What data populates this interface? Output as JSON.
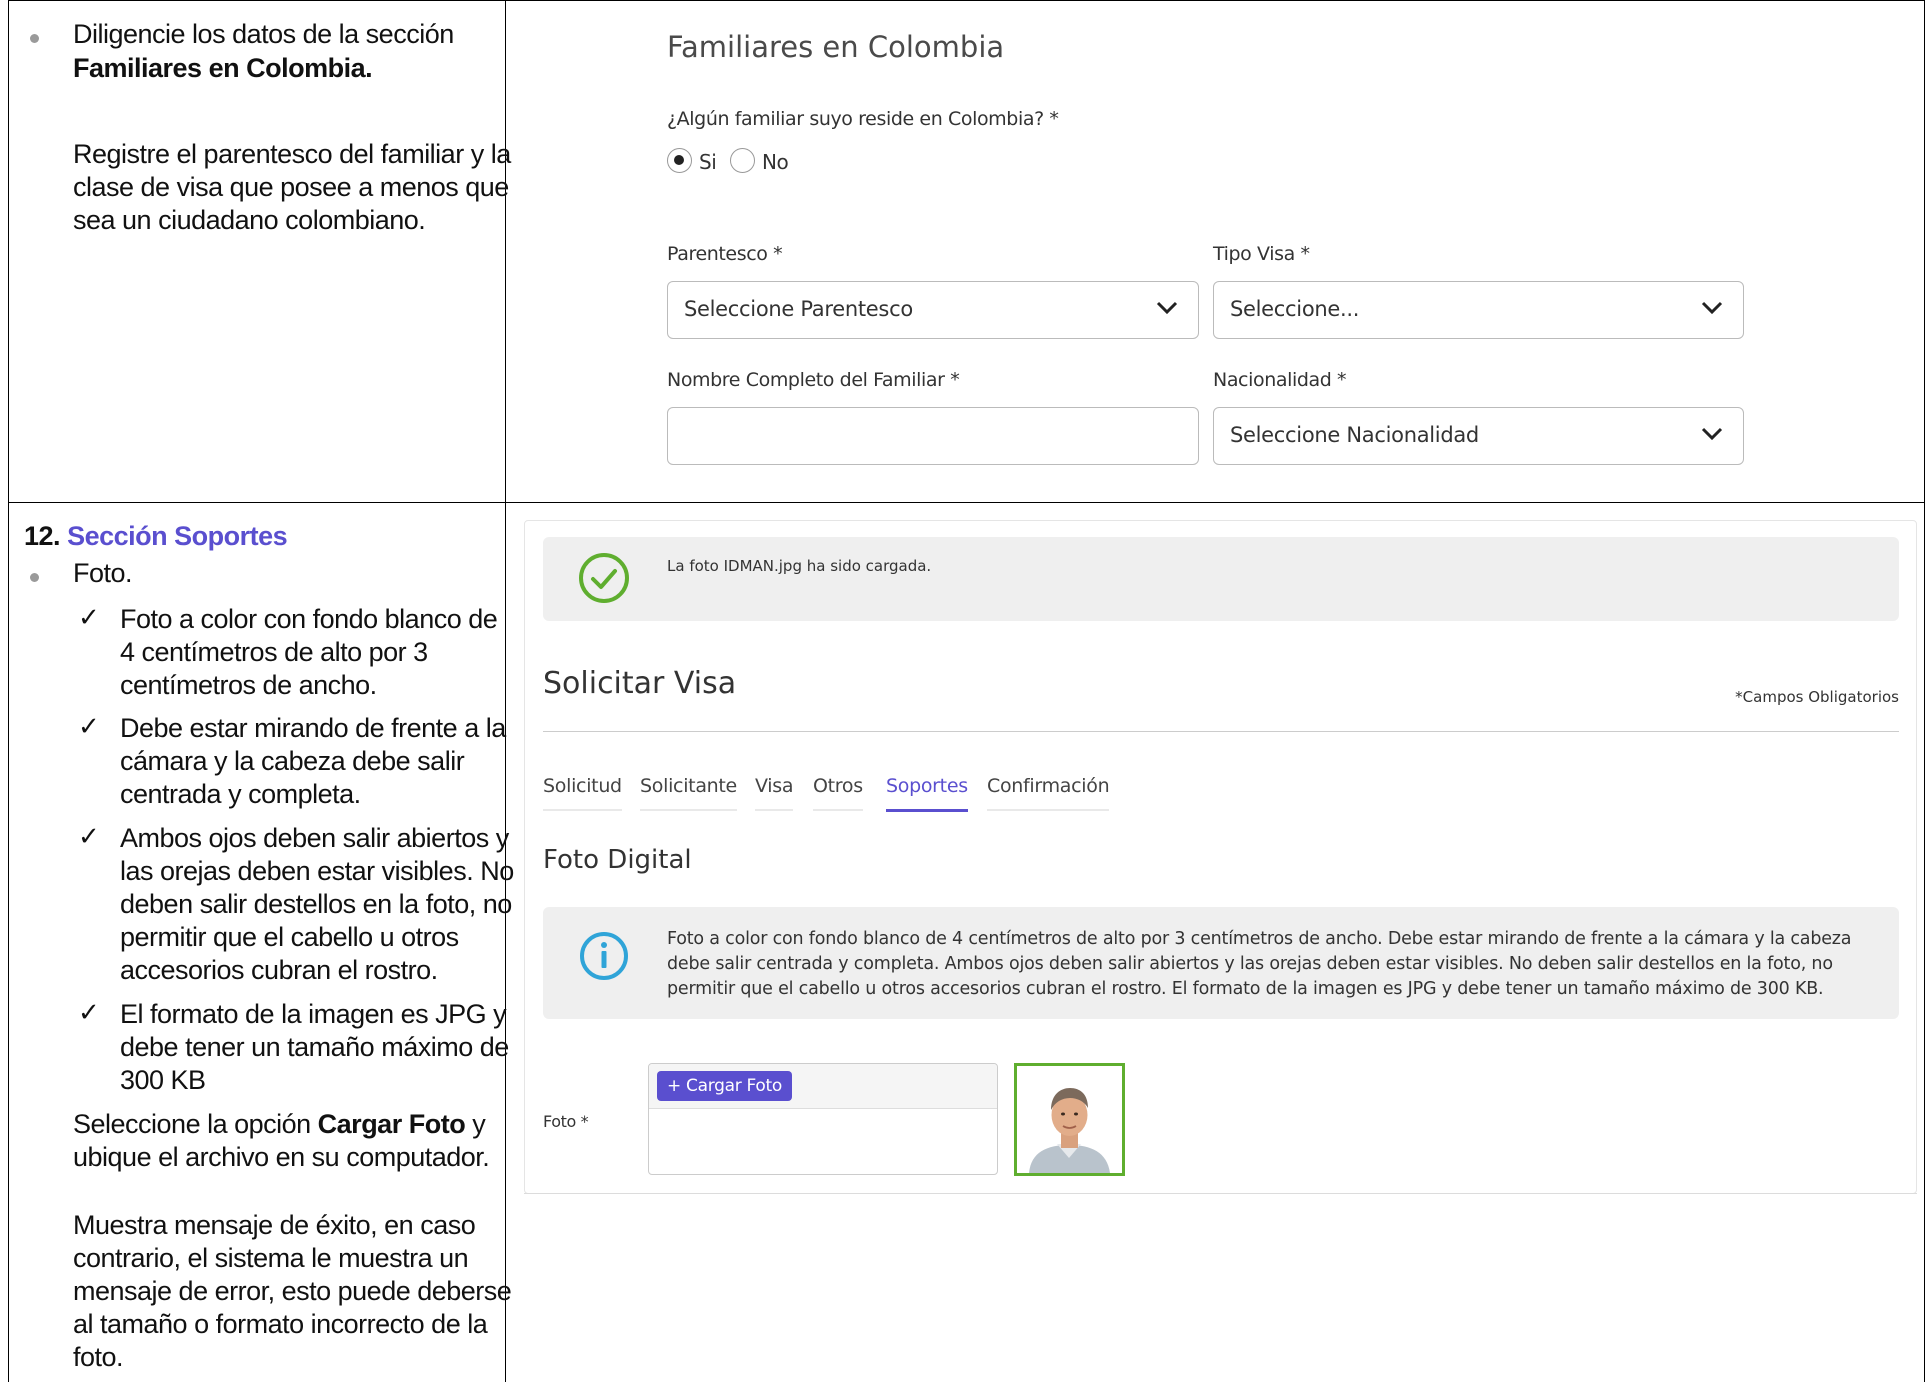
{
  "left_top": {
    "line1": "Diligencie los datos de la sección",
    "line2_bold": "Familiares en Colombia.",
    "para": [
      "Registre el parentesco del familiar y la",
      "clase de visa que posee a menos que",
      "sea un ciudadano colombiano."
    ]
  },
  "left_bottom": {
    "section_number": "12.",
    "section_title": "Sección Soportes",
    "bullet_foto": "Foto.",
    "checks": [
      [
        "Foto a color con fondo blanco de",
        "4 centímetros de alto por 3",
        "centímetros de ancho."
      ],
      [
        "Debe estar mirando de frente a la",
        "cámara y la cabeza debe salir",
        "centrada y completa."
      ],
      [
        "Ambos ojos deben salir abiertos y",
        "las orejas deben estar visibles. No",
        "deben salir destellos en la foto, no",
        "permitir que el cabello u otros",
        "accesorios cubran el rostro."
      ],
      [
        "El formato de la imagen es JPG y",
        "debe tener un tamaño máximo de",
        "300 KB"
      ]
    ],
    "select_pre": "Seleccione la opción ",
    "select_bold": "Cargar Foto",
    "select_post": " y",
    "select_line2": "ubique el archivo en su computador.",
    "result": [
      "Muestra mensaje de éxito, en caso",
      "contrario, el sistema le muestra un",
      "mensaje de error, esto puede deberse",
      "al tamaño o formato incorrecto de la",
      "foto."
    ]
  },
  "familiares": {
    "title": "Familiares en Colombia",
    "question": "¿Algún familiar suyo reside en Colombia? *",
    "option_si": "Si",
    "option_no": "No",
    "selected": "Si",
    "parentesco_label": "Parentesco *",
    "parentesco_value": "Seleccione Parentesco",
    "tipo_visa_label": "Tipo Visa *",
    "tipo_visa_value": "Seleccione...",
    "nombre_label": "Nombre Completo del Familiar *",
    "nombre_value": "",
    "nacionalidad_label": "Nacionalidad *",
    "nacionalidad_value": "Seleccione Nacionalidad"
  },
  "soportes": {
    "success_message": "La foto IDMAN.jpg ha sido cargada.",
    "page_title": "Solicitar Visa",
    "required_note": "*Campos Obligatorios",
    "tabs": [
      "Solicitud",
      "Solicitante",
      "Visa",
      "Otros",
      "Soportes",
      "Confirmación"
    ],
    "active_tab": "Soportes",
    "foto_title": "Foto Digital",
    "info_text": "Foto a color con fondo blanco de 4 centímetros de alto por 3 centímetros de ancho. Debe estar mirando de frente a la cámara y la cabeza debe salir centrada y completa. Ambos ojos deben salir abiertos y las orejas deben estar visibles. No deben salir destellos en la foto, no permitir que el cabello u otros accesorios cubran el rostro. El formato de la imagen es JPG y debe tener un tamaño máximo de 300 KB.",
    "foto_label": "Foto *",
    "upload_button": "+ Cargar Foto"
  },
  "colors": {
    "accent": "#5a4fcf",
    "success": "#5fae2f",
    "info": "#2fa4d8"
  },
  "icons": [
    "check-icon",
    "success-check-circle-icon",
    "info-circle-icon",
    "chevron-down-icon",
    "plus-icon"
  ]
}
